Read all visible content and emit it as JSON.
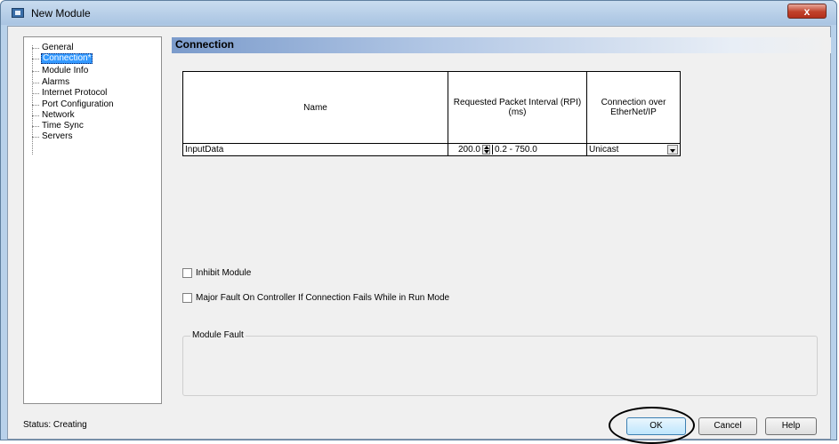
{
  "window": {
    "title": "New Module",
    "close_glyph": "x"
  },
  "tree": {
    "items": [
      {
        "label": "General",
        "selected": false
      },
      {
        "label": "Connection*",
        "selected": true
      },
      {
        "label": "Module Info",
        "selected": false
      },
      {
        "label": "Alarms",
        "selected": false
      },
      {
        "label": "Internet Protocol",
        "selected": false
      },
      {
        "label": "Port Configuration",
        "selected": false
      },
      {
        "label": "Network",
        "selected": false
      },
      {
        "label": "Time Sync",
        "selected": false
      },
      {
        "label": "Servers",
        "selected": false
      }
    ]
  },
  "section": {
    "title": "Connection"
  },
  "table": {
    "headers": [
      "Name",
      "Requested Packet Interval (RPI)\n(ms)",
      "Connection over\nEtherNet/IP"
    ],
    "row": {
      "name": "InputData",
      "rpi_value": "200.0",
      "rpi_range": "0.2 - 750.0",
      "connection": "Unicast"
    }
  },
  "options": {
    "inhibit_label": "Inhibit Module",
    "inhibit_checked": false,
    "major_fault_label": "Major Fault On Controller If Connection Fails While in Run Mode",
    "major_fault_checked": false
  },
  "module_fault": {
    "label": "Module Fault"
  },
  "status": {
    "text": "Status:  Creating"
  },
  "buttons": {
    "ok": "OK",
    "cancel": "Cancel",
    "help": "Help"
  },
  "colors": {
    "selection": "#3399ff",
    "header_gradient": "#7b9bcb",
    "title_bar": "#b8d1ea",
    "close_button": "#c0412b"
  }
}
